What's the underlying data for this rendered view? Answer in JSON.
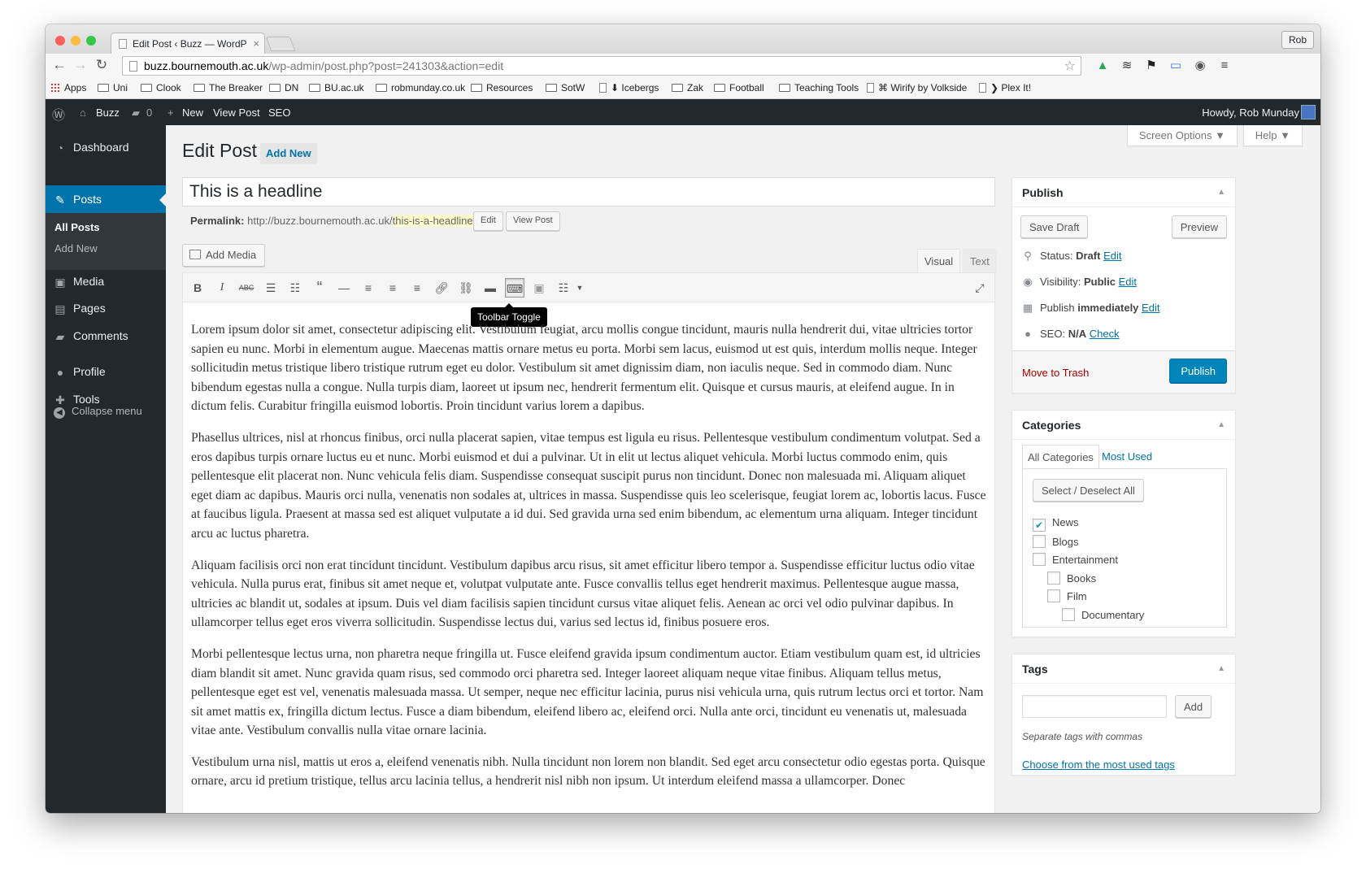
{
  "browser": {
    "tab_title": "Edit Post ‹ Buzz — WordP",
    "tab_close": "×",
    "profile": "Rob",
    "url_host": "buzz.bournemouth.ac.uk",
    "url_path": "/wp-admin/post.php?post=241303&action=edit",
    "bookmarks": [
      {
        "label": "Apps",
        "kind": "apps"
      },
      {
        "label": "Uni",
        "kind": "folder"
      },
      {
        "label": "Clook",
        "kind": "folder"
      },
      {
        "label": "The Breaker",
        "kind": "folder"
      },
      {
        "label": "DN",
        "kind": "folder"
      },
      {
        "label": "BU.ac.uk",
        "kind": "folder"
      },
      {
        "label": "robmunday.co.uk",
        "kind": "folder"
      },
      {
        "label": "Resources",
        "kind": "folder"
      },
      {
        "label": "SotW",
        "kind": "folder"
      },
      {
        "label": "⬇ Icebergs",
        "kind": "page"
      },
      {
        "label": "Zak",
        "kind": "folder"
      },
      {
        "label": "Football",
        "kind": "folder"
      },
      {
        "label": "Teaching Tools",
        "kind": "folder"
      },
      {
        "label": "⌘ Wirify by Volkside",
        "kind": "page"
      },
      {
        "label": "❯ Plex It!",
        "kind": "page"
      }
    ]
  },
  "adminbar": {
    "site": "Buzz",
    "comments": "0",
    "new": "New",
    "view_post": "View Post",
    "seo": "SEO",
    "howdy": "Howdy, Rob Munday"
  },
  "sidebar": {
    "dashboard": "Dashboard",
    "posts": "Posts",
    "all_posts": "All Posts",
    "add_new": "Add New",
    "media": "Media",
    "pages": "Pages",
    "comments": "Comments",
    "profile": "Profile",
    "tools": "Tools",
    "collapse": "Collapse menu"
  },
  "screen": {
    "screen_options": "Screen Options ▼",
    "help": "Help ▼"
  },
  "editor": {
    "heading": "Edit Post",
    "add_new": "Add New",
    "title_value": "This is a headline",
    "permalink_label": "Permalink:",
    "permalink_base": "http://buzz.bournemouth.ac.uk/",
    "permalink_slug": "this-is-a-headline",
    "permalink_end": "/",
    "edit": "Edit",
    "view_post": "View Post",
    "add_media": "Add Media",
    "visual": "Visual",
    "text": "Text",
    "tooltip": "Toolbar Toggle",
    "paragraphs": [
      "Lorem ipsum dolor sit amet, consectetur adipiscing elit. Vestibulum feugiat, arcu mollis congue tincidunt, mauris nulla hendrerit dui, vitae ultricies tortor sapien eu nunc. Morbi in elementum augue. Maecenas mattis ornare metus eu porta. Morbi sem lacus, euismod ut est quis, interdum mollis neque. Integer sollicitudin metus tristique libero tristique rutrum eget eu dolor. Vestibulum sit amet dignissim diam, non iaculis neque. Sed in commodo diam. Nunc bibendum egestas nulla a congue. Nulla turpis diam, laoreet ut ipsum nec, hendrerit fermentum elit. Quisque et cursus mauris, at eleifend augue. In in dictum felis. Curabitur fringilla euismod lobortis. Proin tincidunt varius lorem a dapibus.",
      "Phasellus ultrices, nisl at rhoncus finibus, orci nulla placerat sapien, vitae tempus est ligula eu risus. Pellentesque vestibulum condimentum volutpat. Sed a eros dapibus turpis ornare luctus eu et nunc. Morbi euismod et dui a pulvinar. Ut in elit ut lectus aliquet vehicula. Morbi luctus commodo enim, quis pellentesque elit placerat non. Nunc vehicula felis diam. Suspendisse consequat suscipit purus non tincidunt. Donec non malesuada mi. Aliquam aliquet eget diam ac dapibus. Mauris orci nulla, venenatis non sodales at, ultrices in massa. Suspendisse quis leo scelerisque, feugiat lorem ac, lobortis lacus. Fusce at faucibus ligula. Praesent at massa sed est aliquet vulputate a id dui. Sed gravida urna sed enim bibendum, ac elementum urna aliquam. Integer tincidunt arcu ac luctus pharetra.",
      "Aliquam facilisis orci non erat tincidunt tincidunt. Vestibulum dapibus arcu risus, sit amet efficitur libero tempor a. Suspendisse efficitur luctus odio vitae vehicula. Nulla purus erat, finibus sit amet neque et, volutpat vulputate ante. Fusce convallis tellus eget hendrerit maximus. Pellentesque augue massa, ultricies ac blandit ut, sodales at ipsum. Duis vel diam facilisis sapien tincidunt cursus vitae aliquet felis. Aenean ac orci vel odio pulvinar dapibus. In ullamcorper tellus eget eros viverra sollicitudin. Suspendisse lectus dui, varius sed lectus id, finibus posuere eros.",
      "Morbi pellentesque lectus urna, non pharetra neque fringilla ut. Fusce eleifend gravida ipsum condimentum auctor. Etiam vestibulum quam est, id ultricies diam blandit sit amet. Nunc gravida quam risus, sed commodo orci pharetra sed. Integer laoreet aliquam neque vitae finibus. Aliquam tellus metus, pellentesque eget est vel, venenatis malesuada massa. Ut semper, neque nec efficitur lacinia, purus nisi vehicula urna, quis rutrum lectus orci et tortor. Nam sit amet mattis ex, fringilla dictum lectus. Fusce a diam bibendum, eleifend libero ac, eleifend orci. Nulla ante orci, tincidunt eu venenatis ut, malesuada vitae ante. Vestibulum convallis nulla vitae ornare lacinia.",
      "Vestibulum urna nisl, mattis ut eros a, eleifend venenatis nibh. Nulla tincidunt non lorem non blandit. Sed eget arcu consectetur odio egestas porta. Quisque ornare, arcu id pretium tristique, tellus arcu lacinia tellus, a hendrerit nisl nibh non ipsum. Ut interdum eleifend massa a ullamcorper. Donec"
    ]
  },
  "publish": {
    "title": "Publish",
    "save_draft": "Save Draft",
    "preview": "Preview",
    "status_label": "Status:",
    "status_value": "Draft",
    "visibility_label": "Visibility:",
    "visibility_value": "Public",
    "publish_label": "Publish",
    "publish_value": "immediately",
    "seo_label": "SEO:",
    "seo_value": "N/A",
    "edit": "Edit",
    "check": "Check",
    "trash": "Move to Trash",
    "publish_btn": "Publish"
  },
  "categories": {
    "title": "Categories",
    "tab_all": "All Categories",
    "tab_used": "Most Used",
    "select_all": "Select / Deselect All",
    "items": [
      {
        "label": "News",
        "checked": true
      },
      {
        "label": "Blogs",
        "checked": false
      },
      {
        "label": "Entertainment",
        "checked": false
      },
      {
        "label": "Books",
        "checked": false
      },
      {
        "label": "Film",
        "checked": false
      },
      {
        "label": "Documentary",
        "checked": false
      }
    ]
  },
  "tags": {
    "title": "Tags",
    "add": "Add",
    "hint": "Separate tags with commas",
    "choose": "Choose from the most used tags"
  }
}
